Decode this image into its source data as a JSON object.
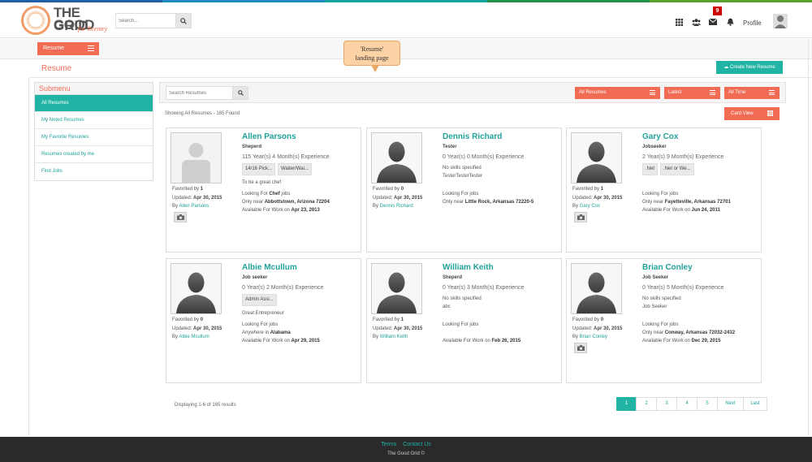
{
  "colors": {
    "accent": "#f26b55",
    "teal": "#21b3a4",
    "footer": "#2a2a2a"
  },
  "header": {
    "logo": {
      "the_good": "THE GOOD",
      "grid": "GRID",
      "tagline": "for Reentry"
    },
    "search": {
      "placeholder": "Search..."
    },
    "icons": [
      "apps-grid-icon",
      "users-icon",
      "envelope-icon",
      "bell-icon"
    ],
    "notification_count": "9",
    "profile_label": "Profile"
  },
  "toolbar": {
    "resume_menu_label": "Resume"
  },
  "callout": {
    "line1": "'Resume'",
    "line2": "landing page"
  },
  "page": {
    "title": "Resume",
    "create_button": "Create New Resume"
  },
  "submenu": {
    "title": "Submenu",
    "items": [
      "All Resumes",
      "My Noted Resumes",
      "My Favorite Resumes",
      "Resumes created by me",
      "Find Jobs"
    ]
  },
  "filters": {
    "search_placeholder": "Search Resumes",
    "all_resumes": "All Resumes",
    "latest": "Latest",
    "all_time": "All Time"
  },
  "listing": {
    "showing": "Showing All Resumes - 165 Found",
    "card_view": "Card View"
  },
  "cards": [
    {
      "name": "Allen Parsons",
      "role": "Sheperd",
      "experience": "115 Year(s) 4 Month(s) Experience",
      "tags": [
        "14/16 Pick...",
        "Waiter/Wai..."
      ],
      "summary": "To be a great chef",
      "looking_prefix": "Looking For ",
      "looking_bold": "Chef",
      "looking_suffix": " jobs",
      "near_prefix": "Only near ",
      "near_bold": "Abbottstown, Arizona 72204",
      "avail_prefix": "Available For Work on ",
      "avail_bold": "Apr 23, 2013",
      "favorited": "1",
      "updated": "Apr 30, 2015",
      "by": "Allen Parsons",
      "has_camera": true
    },
    {
      "name": "Dennis Richard",
      "role": "Tester",
      "experience": "0 Year(s) 0 Month(s) Experience",
      "skills_text": "No skills specified",
      "summary": "TesterTesterTester",
      "looking_prefix": "Looking For jobs",
      "looking_bold": "",
      "looking_suffix": "",
      "near_prefix": "Only near ",
      "near_bold": "Little Rock, Arkansas 72220-5",
      "avail_prefix": "",
      "avail_bold": "",
      "favorited": "0",
      "updated": "Apr 30, 2015",
      "by": "Dennis Richard",
      "has_camera": false
    },
    {
      "name": "Gary Cox",
      "role": "Jobseeker",
      "experience": "2 Year(s) 9 Month(s) Experience",
      "tags": [
        ".Net",
        ".Net or We..."
      ],
      "looking_prefix": "Looking For jobs",
      "looking_bold": "",
      "looking_suffix": "",
      "near_prefix": "Only near ",
      "near_bold": "Fayetteville, Arkansas 72701",
      "avail_prefix": "Available For Work on ",
      "avail_bold": "Jun 24, 2011",
      "favorited": "1",
      "updated": "Apr 30, 2015",
      "by": "Gary Cox",
      "has_camera": true
    },
    {
      "name": "Albie Mcullum",
      "role": "Job seeker",
      "experience": "0 Year(s) 2 Month(s) Experience",
      "tags": [
        "Admin Assi..."
      ],
      "summary": "Great Entrepreneur",
      "looking_prefix": "Looking For jobs",
      "looking_bold": "",
      "looking_suffix": "",
      "near_prefix": "Anywhere in ",
      "near_bold": "Alabama",
      "avail_prefix": "Available For Work on ",
      "avail_bold": "Apr 29, 2015",
      "favorited": "0",
      "updated": "Apr 30, 2015",
      "by": "Albie Mcullum",
      "has_camera": false
    },
    {
      "name": "William Keith",
      "role": "Sheperd",
      "experience": "0 Year(s) 3 Month(s) Experience",
      "skills_text": "No skills specified",
      "summary": "abc",
      "looking_prefix": "Looking For jobs",
      "looking_bold": "",
      "looking_suffix": "",
      "near_prefix": "",
      "near_bold": "",
      "avail_prefix": "Available For Work on ",
      "avail_bold": "Feb 26, 2015",
      "favorited": "1",
      "updated": "Apr 30, 2015",
      "by": "William Keith",
      "has_camera": false
    },
    {
      "name": "Brian Conley",
      "role": "Job Seeker",
      "experience": "0 Year(s) 5 Month(s) Experience",
      "skills_text": "No skills specified",
      "summary": "Job Seeker",
      "looking_prefix": "Looking For jobs",
      "looking_bold": "",
      "looking_suffix": "",
      "near_prefix": "Only near ",
      "near_bold": "Conway, Arkansas 72032-2432",
      "avail_prefix": "Available For Work on ",
      "avail_bold": "Dec 29, 2015",
      "favorited": "0",
      "updated": "Apr 30, 2015",
      "by": "Brian Conley",
      "has_camera": true
    }
  ],
  "card_labels": {
    "favorited_by": "Favorited by ",
    "updated": "Updated: ",
    "by": "By "
  },
  "pagination": {
    "summary": "Displaying 1-6 of 165 results",
    "pages": [
      "1",
      "2",
      "3",
      "4",
      "5",
      "Next",
      "Last"
    ],
    "active": "1"
  },
  "footer": {
    "terms": "Terms",
    "contact": "Contact Us",
    "copyright": "The Good Grid ©"
  }
}
